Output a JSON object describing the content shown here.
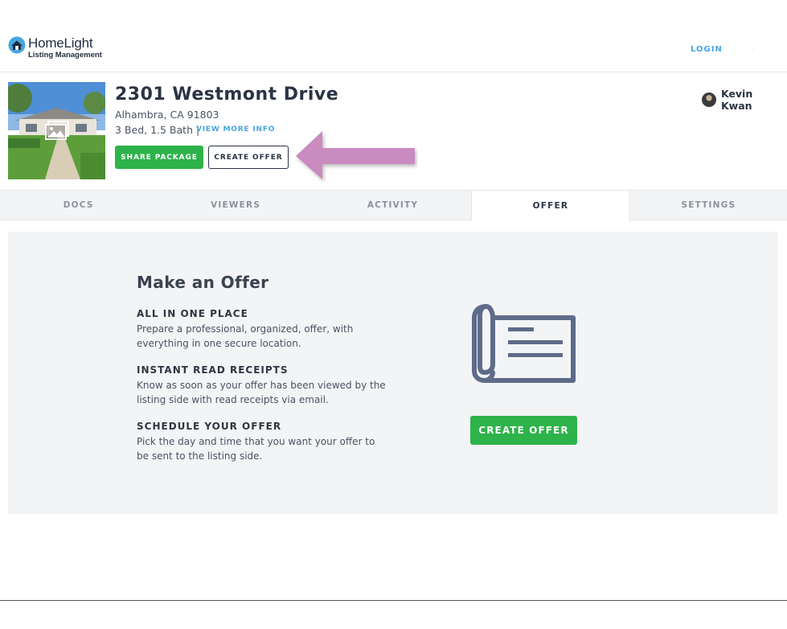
{
  "header": {
    "logo_name": "HomeLight",
    "logo_sub": "Listing Management",
    "login_label": "LOGIN"
  },
  "listing": {
    "address": "2301 Westmont Drive",
    "city": "Alhambra, CA 91803",
    "specs": "3 Bed, 1.5 Bath |",
    "view_more_label": "VIEW MORE INFO",
    "share_label": "SHARE PACKAGE",
    "create_offer_label": "CREATE OFFER",
    "user_name": "Kevin Kwan"
  },
  "tabs": [
    {
      "label": "DOCS",
      "active": false
    },
    {
      "label": "VIEWERS",
      "active": false
    },
    {
      "label": "ACTIVITY",
      "active": false
    },
    {
      "label": "OFFER",
      "active": true
    },
    {
      "label": "SETTINGS",
      "active": false
    }
  ],
  "offer": {
    "title": "Make an Offer",
    "features": [
      {
        "heading": "ALL IN ONE PLACE",
        "body": "Prepare a professional, organized, offer, with everything in one secure location."
      },
      {
        "heading": "INSTANT READ RECEIPTS",
        "body": "Know as soon as your offer has been viewed by the listing side with read receipts via email."
      },
      {
        "heading": "SCHEDULE YOUR OFFER",
        "body": "Pick the day and time that you want your offer to be sent to the listing side."
      }
    ],
    "create_offer_label": "CREATE OFFER",
    "icon": "document-scroll-icon"
  },
  "colors": {
    "brand_green": "#2db34a",
    "link_blue": "#46a6e0",
    "arrow_pink": "#c98bc0",
    "panel_bg": "#f3f4f6",
    "icon_slate": "#5e6b89"
  }
}
